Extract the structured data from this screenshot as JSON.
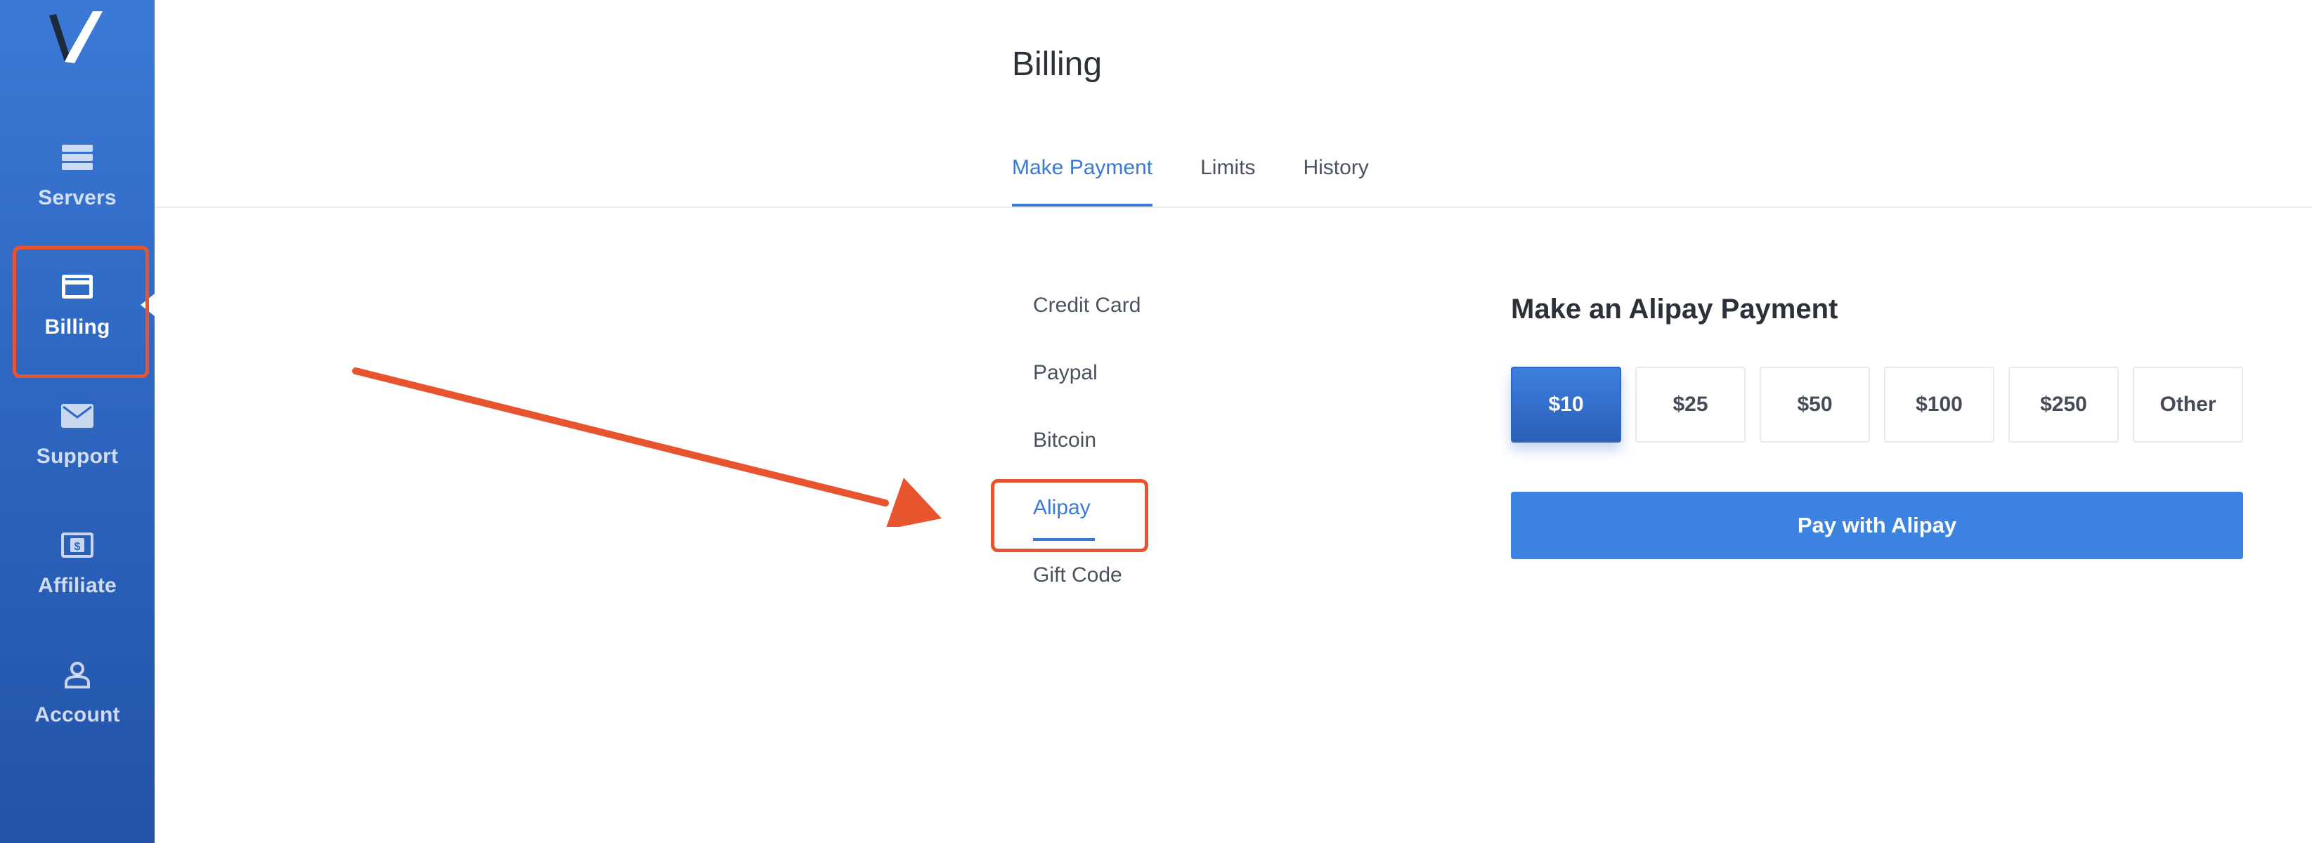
{
  "sidebar": {
    "logo_icon": "v-logo-icon",
    "items": [
      {
        "label": "Servers",
        "icon": "servers-icon"
      },
      {
        "label": "Billing",
        "icon": "credit-card-icon",
        "active": true
      },
      {
        "label": "Support",
        "icon": "envelope-icon"
      },
      {
        "label": "Affiliate",
        "icon": "dollar-bill-icon"
      },
      {
        "label": "Account",
        "icon": "user-icon"
      }
    ]
  },
  "header": {
    "title": "Billing",
    "tabs": [
      {
        "label": "Make Payment",
        "active": true
      },
      {
        "label": "Limits"
      },
      {
        "label": "History"
      }
    ]
  },
  "payment_methods": [
    {
      "label": "Credit Card"
    },
    {
      "label": "Paypal"
    },
    {
      "label": "Bitcoin"
    },
    {
      "label": "Alipay",
      "active": true
    },
    {
      "label": "Gift Code"
    }
  ],
  "panel": {
    "title": "Make an Alipay Payment",
    "amounts": [
      {
        "label": "$10",
        "selected": true
      },
      {
        "label": "$25"
      },
      {
        "label": "$50"
      },
      {
        "label": "$100"
      },
      {
        "label": "$250"
      },
      {
        "label": "Other"
      }
    ],
    "pay_button_label": "Pay with Alipay"
  },
  "colors": {
    "accent": "#3a7ad6",
    "sidebar_bg": "#2e67c2",
    "annotation": "#e8542e",
    "text_dark": "#2b3039"
  }
}
